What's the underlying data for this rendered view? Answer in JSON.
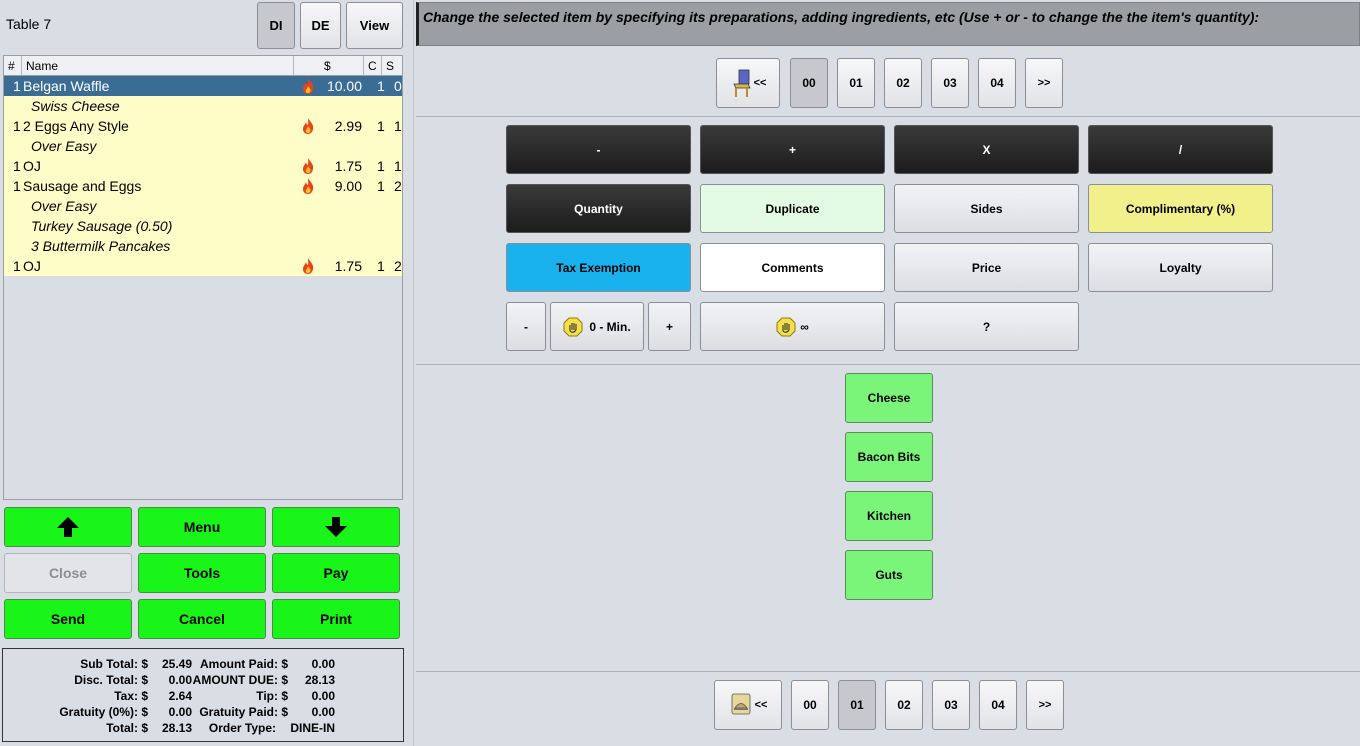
{
  "table": {
    "label": "Table 7"
  },
  "top_buttons": {
    "di": "DI",
    "de": "DE",
    "view": "View"
  },
  "order": {
    "headers": {
      "num": "#",
      "name": "Name",
      "price": "$",
      "c": "C",
      "s": "S"
    },
    "rows": [
      {
        "qty": "1",
        "name": "Belgan Waffle",
        "price": "10.00",
        "c": "1",
        "s": "0"
      },
      {
        "sub": "Swiss Cheese"
      },
      {
        "qty": "1",
        "name": "2 Eggs Any Style",
        "price": "2.99",
        "c": "1",
        "s": "1"
      },
      {
        "sub": "Over Easy"
      },
      {
        "qty": "1",
        "name": "OJ",
        "price": "1.75",
        "c": "1",
        "s": "1"
      },
      {
        "qty": "1",
        "name": "Sausage and Eggs",
        "price": "9.00",
        "c": "1",
        "s": "2"
      },
      {
        "sub": "Over Easy"
      },
      {
        "sub": "Turkey Sausage (0.50)"
      },
      {
        "sub": "3 Buttermilk Pancakes"
      },
      {
        "qty": "1",
        "name": "OJ",
        "price": "1.75",
        "c": "1",
        "s": "2"
      }
    ]
  },
  "actions": {
    "menu": "Menu",
    "close": "Close",
    "tools": "Tools",
    "pay": "Pay",
    "send": "Send",
    "cancel": "Cancel",
    "print": "Print"
  },
  "totals": {
    "subtotal_label": "Sub Total: $",
    "subtotal": "25.49",
    "disc_label": "Disc. Total: $",
    "disc": "0.00",
    "tax_label": "Tax: $",
    "tax": "2.64",
    "gratuity_label": "Gratuity (0%): $",
    "gratuity": "0.00",
    "total_label": "Total: $",
    "total": "28.13",
    "amount_paid_label": "Amount Paid: $",
    "amount_paid": "0.00",
    "amount_due_label": "AMOUNT DUE: $",
    "amount_due": "28.13",
    "tip_label": "Tip: $",
    "tip": "0.00",
    "gratuity_paid_label": "Gratuity Paid: $",
    "gratuity_paid": "0.00",
    "order_type_label": "Order Type:",
    "order_type": "DINE-IN"
  },
  "instructions": "Change the selected item by specifying its preparations, adding ingredients, etc (Use + or - to change the the item's quantity):",
  "seat_nav": {
    "prev": "<<",
    "next": ">>",
    "pages": [
      "00",
      "01",
      "02",
      "03",
      "04"
    ],
    "selected": "00"
  },
  "modifiers": {
    "minus": "-",
    "plus": "+",
    "times": "X",
    "divide": "/",
    "quantity": "Quantity",
    "duplicate": "Duplicate",
    "sides": "Sides",
    "complimentary": "Complimentary (%)",
    "tax_exemption": "Tax Exemption",
    "comments": "Comments",
    "price": "Price",
    "loyalty": "Loyalty",
    "min_minus": "-",
    "min_label": "0 - Min.",
    "min_plus": "+",
    "infinity": "∞",
    "question": "?"
  },
  "ingredients": [
    "Cheese",
    "Bacon Bits",
    "Kitchen",
    "Guts"
  ],
  "bottom_nav": {
    "prev": "<<",
    "next": ">>",
    "pages": [
      "00",
      "01",
      "02",
      "03",
      "04"
    ],
    "selected": "01"
  },
  "colors": {
    "selected_row": "#3b6c93",
    "item_row": "#fefdc8",
    "green": "#19f519",
    "ingredient": "#7af57a"
  }
}
